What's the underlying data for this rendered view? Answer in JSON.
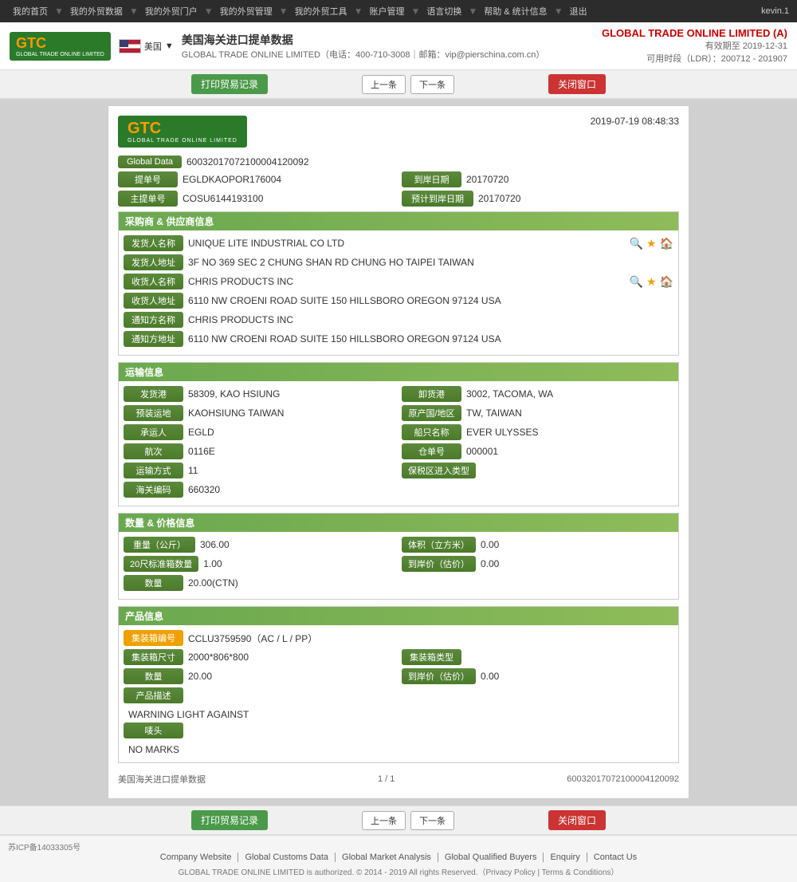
{
  "topnav": {
    "items": [
      "我的首页",
      "我的外贸数据",
      "我的外贸门户",
      "我的外贸管理",
      "我的外贸工具",
      "账户管理",
      "语言切换",
      "帮助 & 统计信息",
      "退出"
    ],
    "user": "kevin.1"
  },
  "header": {
    "logo_gtc": "GTC",
    "logo_sub": "GLOBAL TRADE ONLINE LIMITED",
    "flag_label": "美国",
    "title": "美国海关进口提单数据",
    "subtitle_tel": "GLOBAL TRADE ONLINE LIMITED（电话：400-710-3008｜邮箱：vip@pierschina.com.cn）",
    "brand": "GLOBAL TRADE ONLINE LIMITED (A)",
    "expiry": "有效期至 2019-12-31",
    "ldr": "可用时段（LDR）：200712 - 201907"
  },
  "toolbar": {
    "print_label": "打印贸易记录",
    "prev_label": "上一条",
    "next_label": "下一条",
    "close_label": "关闭窗口"
  },
  "document": {
    "timestamp": "2019-07-19 08:48:33",
    "global_data_label": "Global Data",
    "global_data_value": "60032017072100004120092",
    "bill_no_label": "提单号",
    "bill_no_value": "EGLDKAOPOR176004",
    "arrival_date_label": "到岸日期",
    "arrival_date_value": "20170720",
    "main_bill_label": "主提单号",
    "main_bill_value": "COSU6144193100",
    "est_arrival_label": "预计到岸日期",
    "est_arrival_value": "20170720",
    "sections": {
      "buyer_supplier": {
        "title": "采购商 & 供应商信息",
        "shipper_name_label": "发货人名称",
        "shipper_name_value": "UNIQUE LITE INDUSTRIAL CO LTD",
        "shipper_addr_label": "发货人地址",
        "shipper_addr_value": "3F NO 369 SEC 2 CHUNG SHAN RD CHUNG HO TAIPEI TAIWAN",
        "consignee_name_label": "收货人名称",
        "consignee_name_value": "CHRIS PRODUCTS INC",
        "consignee_addr_label": "收货人地址",
        "consignee_addr_value": "6110 NW CROENI ROAD SUITE 150 HILLSBORO OREGON 97124 USA",
        "notify_name_label": "通知方名称",
        "notify_name_value": "CHRIS PRODUCTS INC",
        "notify_addr_label": "通知方地址",
        "notify_addr_value": "6110 NW CROENI ROAD SUITE 150 HILLSBORO OREGON 97124 USA"
      },
      "transport": {
        "title": "运输信息",
        "origin_port_label": "发货港",
        "origin_port_value": "58309, KAO HSIUNG",
        "dest_port_label": "卸货港",
        "dest_port_value": "3002, TACOMA, WA",
        "load_place_label": "预装运地",
        "load_place_value": "KAOHSIUNG TAIWAN",
        "origin_country_label": "原产国/地区",
        "origin_country_value": "TW, TAIWAN",
        "carrier_label": "承运人",
        "carrier_value": "EGLD",
        "vessel_label": "船只名称",
        "vessel_value": "EVER ULYSSES",
        "voyage_label": "航次",
        "voyage_value": "0116E",
        "warehouse_label": "仓单号",
        "warehouse_value": "000001",
        "transport_mode_label": "运输方式",
        "transport_mode_value": "11",
        "bonded_label": "保税区进入类型",
        "bonded_value": "",
        "customs_code_label": "海关编码",
        "customs_code_value": "660320"
      },
      "quantity_price": {
        "title": "数量 & 价格信息",
        "weight_label": "重量（公斤）",
        "weight_value": "306.00",
        "volume_label": "体积（立方米）",
        "volume_value": "0.00",
        "std_20ft_label": "20尺标准箱数量",
        "std_20ft_value": "1.00",
        "arrival_price_label": "到岸价（估价）",
        "arrival_price_value": "0.00",
        "quantity_label": "数量",
        "quantity_value": "20.00(CTN)"
      },
      "product": {
        "title": "产品信息",
        "container_no_label": "集装箱编号",
        "container_no_value": "CCLU3759590（AC / L / PP）",
        "container_size_label": "集装箱尺寸",
        "container_size_value": "2000*806*800",
        "container_type_label": "集装箱类型",
        "container_type_value": "",
        "quantity_label": "数量",
        "quantity_value": "20.00",
        "arrival_price_label": "到岸价（估价）",
        "arrival_price_value": "0.00",
        "product_desc_label": "产品描述",
        "product_desc_value": "WARNING LIGHT AGAINST",
        "marks_label": "唛头",
        "marks_value": "NO MARKS"
      }
    },
    "footer": {
      "label": "美国海关进口提单数据",
      "page": "1 / 1",
      "id": "60032017072100004120092"
    }
  },
  "page_footer": {
    "icp": "苏ICP备14033305号",
    "links": [
      "Company Website",
      "Global Customs Data",
      "Global Market Analysis",
      "Global Qualified Buyers",
      "Enquiry",
      "Contact Us"
    ],
    "copyright": "GLOBAL TRADE ONLINE LIMITED is authorized. © 2014 - 2019 All rights Reserved.（Privacy Policy | Terms & Conditions）"
  }
}
